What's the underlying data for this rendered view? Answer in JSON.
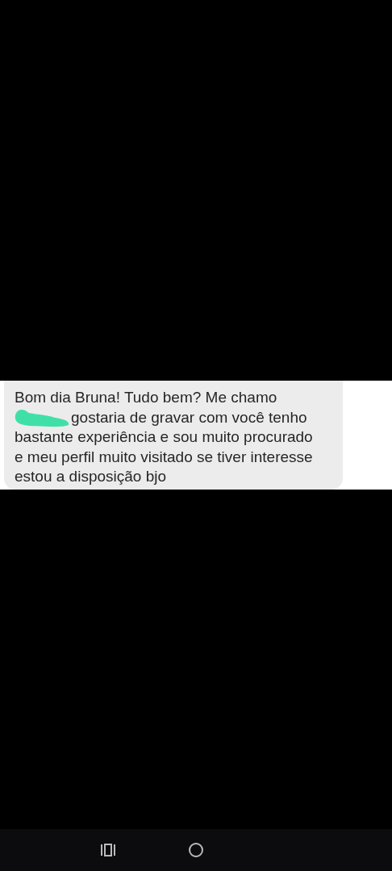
{
  "message": {
    "line_1": "Bom dia Bruna! Tudo bem? Me chamo",
    "redacted": true,
    "line_2": "gostaria de gravar com você tenho",
    "rest": "bastante experiência e sou muito procurado e meu perfil muito visitado se tiver interesse estou a disposição bjo"
  }
}
